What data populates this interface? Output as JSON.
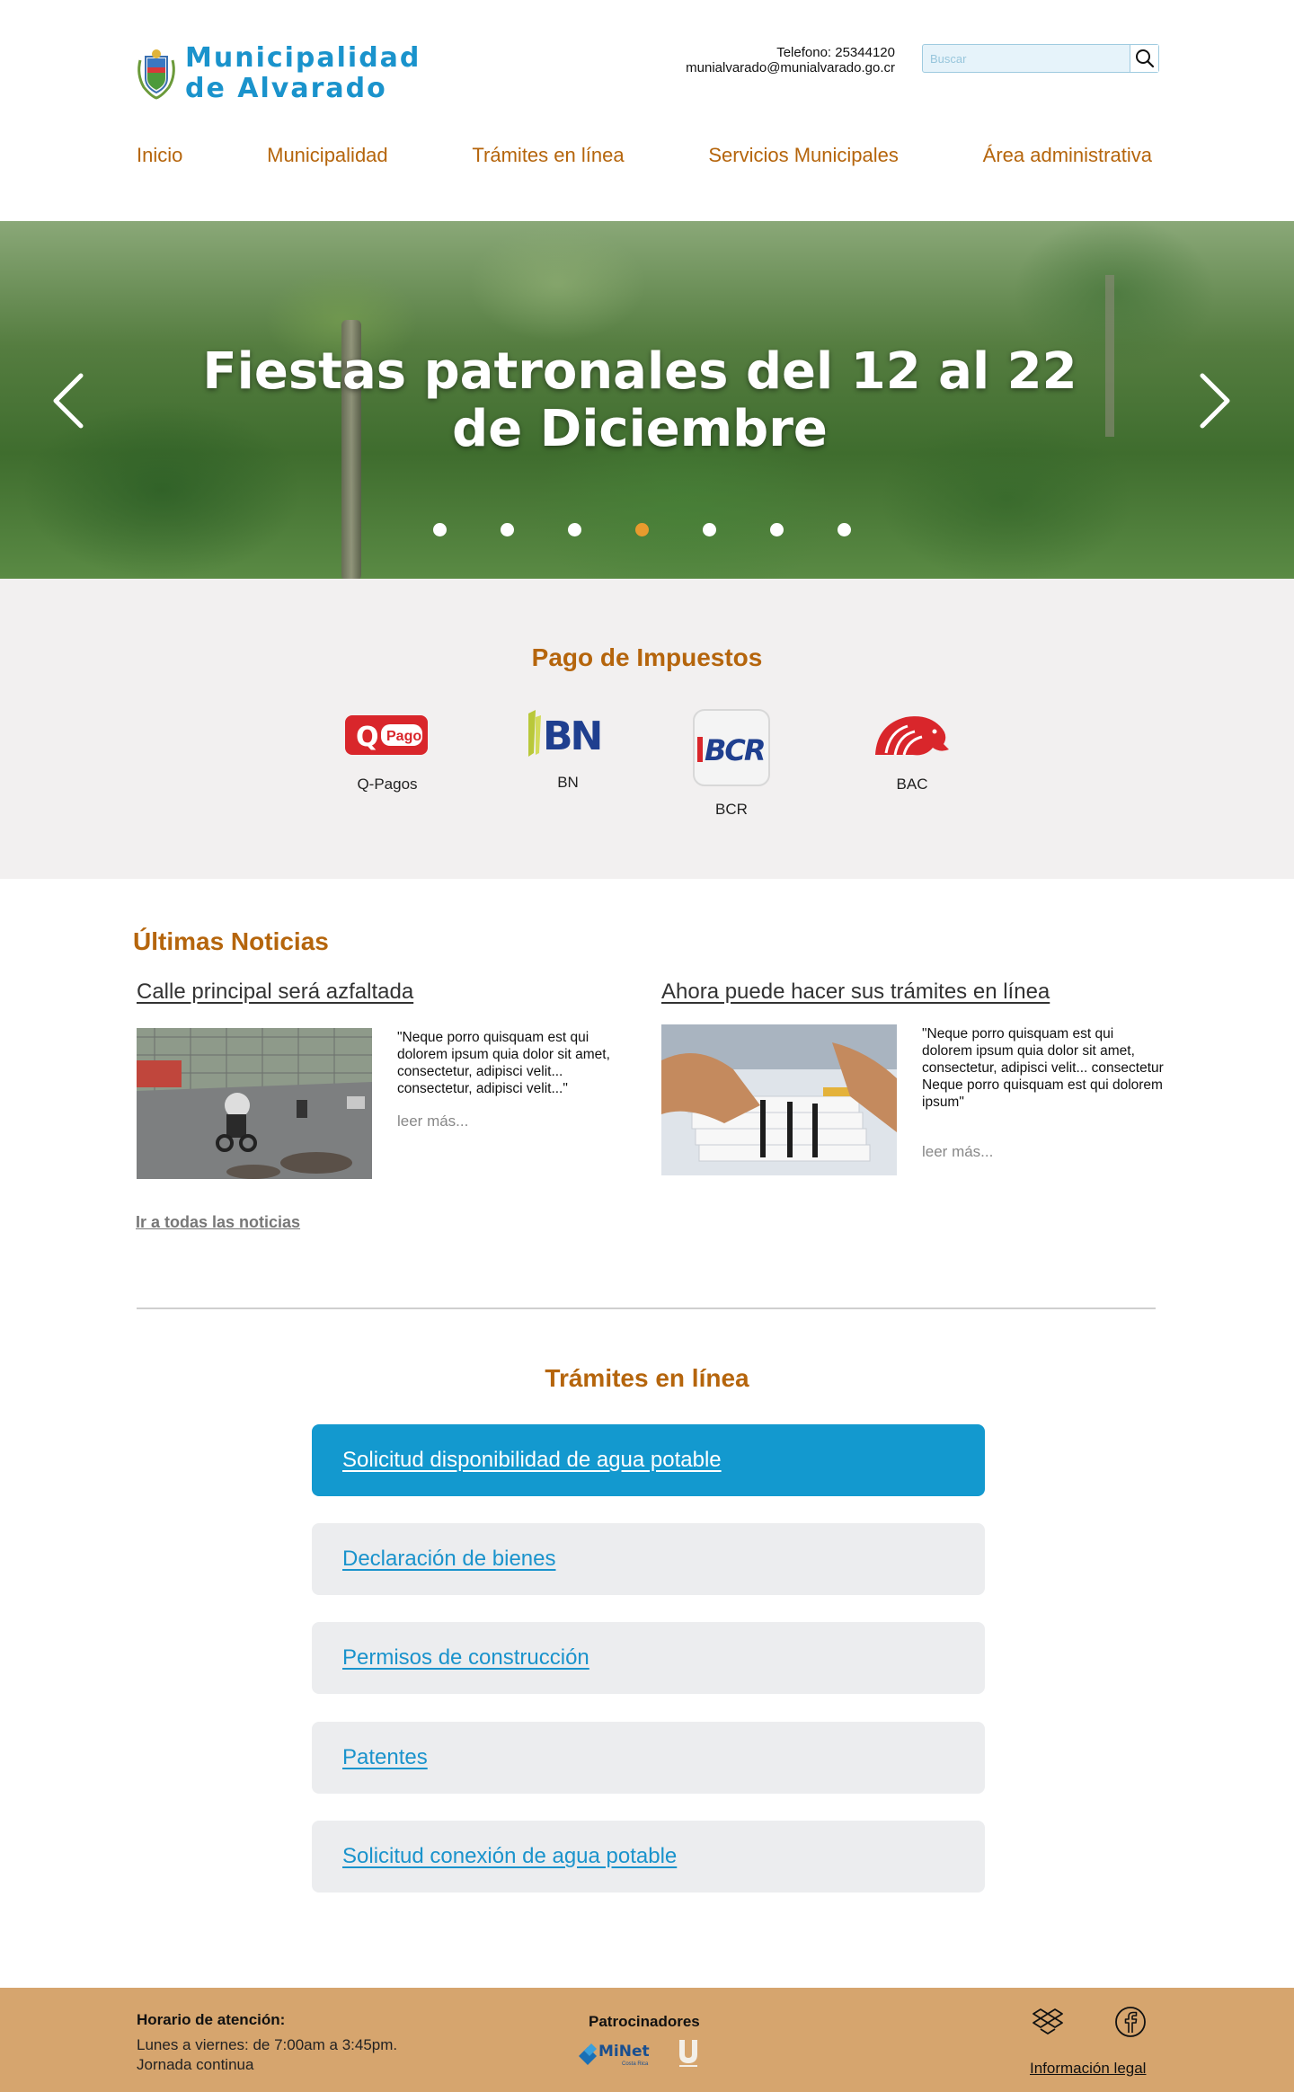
{
  "header": {
    "logo_line1": "Municipalidad",
    "logo_line2": "de Alvarado",
    "phone": "Telefono: 25344120",
    "email": "munialvarado@munialvarado.go.cr",
    "search_placeholder": "Buscar",
    "search_icon": "search-icon"
  },
  "nav": {
    "items": [
      "Inicio",
      "Municipalidad",
      "Trámites en línea",
      "Servicios Municipales",
      "Área administrativa"
    ]
  },
  "hero": {
    "title": "Fiestas patronales del 12 al 22 de Diciembre",
    "slide_count": 7,
    "active_slide": 4,
    "prev_icon": "chevron-left-icon",
    "next_icon": "chevron-right-icon"
  },
  "payments": {
    "title": "Pago de Impuestos",
    "items": [
      {
        "label": "Q-Pagos",
        "logo_text": "Pago"
      },
      {
        "label": "BN",
        "logo_text": "BN"
      },
      {
        "label": "BCR",
        "logo_text": "BCR"
      },
      {
        "label": "BAC",
        "logo_text": ""
      }
    ]
  },
  "news": {
    "title": "Últimas Noticias",
    "items": [
      {
        "headline": "Calle principal será azfaltada",
        "excerpt": "\"Neque porro quisquam est qui dolorem ipsum quia dolor sit amet, consectetur, adipisci velit... consectetur, adipisci velit...\"",
        "more": "leer más..."
      },
      {
        "headline": "Ahora puede hacer sus trámites en línea",
        "excerpt": "\"Neque porro quisquam est qui dolorem ipsum quia dolor sit amet, consectetur, adipisci velit... consectetur\nNeque porro quisquam est qui dolorem ipsum\"",
        "more": "leer más..."
      }
    ],
    "all_link": "Ir a todas las noticias"
  },
  "tramites": {
    "title": "Trámites en línea",
    "items": [
      "Solicitud disponibilidad de agua potable",
      "Declaración de bienes",
      "Permisos de construcción",
      "Patentes",
      "Solicitud conexión de agua potable"
    ],
    "active_index": 0
  },
  "footer": {
    "hours_title": "Horario de atención:",
    "hours_line1": "Lunes a viernes: de 7:00am a 3:45pm.",
    "hours_line2": "Jornada continua",
    "sponsors_title": "Patrocinadores",
    "sponsor1": "MiNet",
    "sponsor1_sub": "Costa Rica",
    "legal": "Información legal",
    "icons": [
      "dropbox-icon",
      "facebook-icon"
    ]
  },
  "colors": {
    "accent_orange": "#b5650c",
    "accent_blue": "#1a93cc",
    "footer_bg": "#d6a56e",
    "active_dot": "#e89b2e"
  }
}
